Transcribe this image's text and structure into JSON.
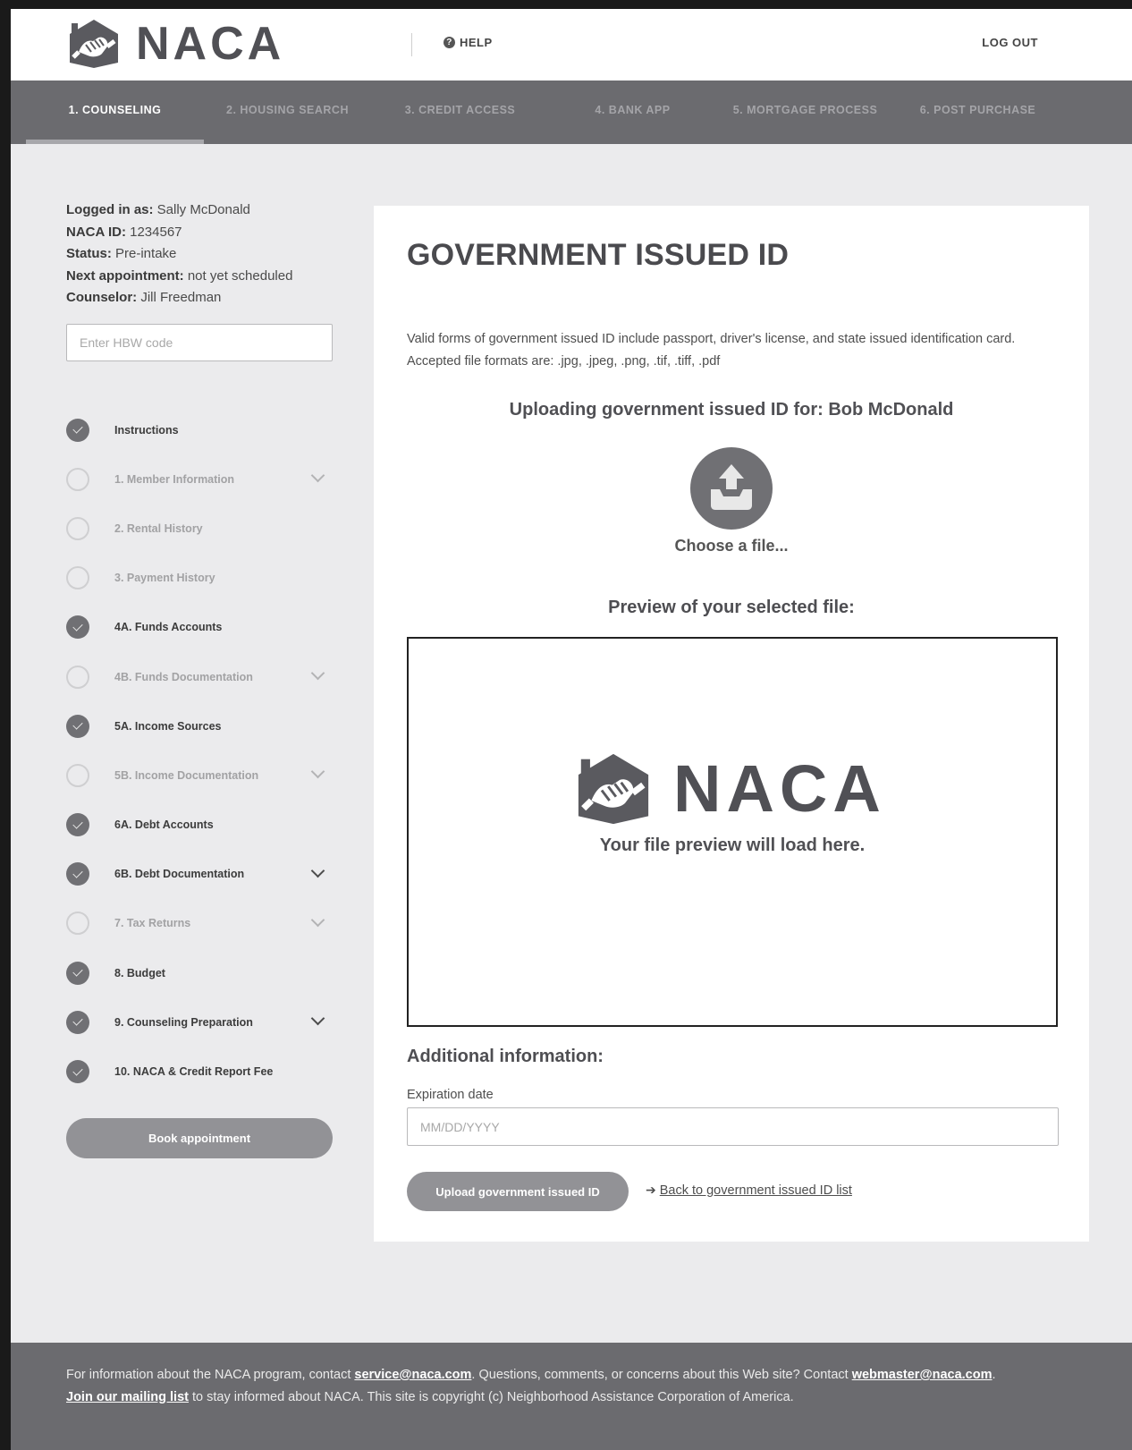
{
  "header": {
    "logo_text": "NACA",
    "help_label": "HELP",
    "logout_label": "LOG OUT"
  },
  "nav": {
    "tabs": [
      {
        "label": "1. COUNSELING",
        "active": true
      },
      {
        "label": "2. HOUSING SEARCH",
        "active": false
      },
      {
        "label": "3. CREDIT ACCESS",
        "active": false
      },
      {
        "label": "4. BANK APP",
        "active": false
      },
      {
        "label": "5. MORTGAGE PROCESS",
        "active": false
      },
      {
        "label": "6. POST PURCHASE",
        "active": false
      }
    ]
  },
  "sidebar": {
    "info": [
      {
        "key": "Logged in as:",
        "value": "Sally McDonald"
      },
      {
        "key": "NACA ID:",
        "value": "1234567"
      },
      {
        "key": "Status:",
        "value": "Pre-intake"
      },
      {
        "key": "Next appointment:",
        "value": "not yet scheduled"
      },
      {
        "key": "Counselor:",
        "value": "Jill Freedman"
      }
    ],
    "hbw_placeholder": "Enter HBW code",
    "steps": [
      {
        "label": "Instructions",
        "done": true,
        "chevron": false
      },
      {
        "label": "1. Member Information",
        "done": false,
        "chevron": true
      },
      {
        "label": "2. Rental History",
        "done": false,
        "chevron": false
      },
      {
        "label": "3. Payment History",
        "done": false,
        "chevron": false
      },
      {
        "label": "4A. Funds Accounts",
        "done": true,
        "chevron": false
      },
      {
        "label": "4B. Funds Documentation",
        "done": false,
        "chevron": true
      },
      {
        "label": "5A. Income Sources",
        "done": true,
        "chevron": false
      },
      {
        "label": "5B. Income Documentation",
        "done": false,
        "chevron": true
      },
      {
        "label": "6A. Debt Accounts",
        "done": true,
        "chevron": false
      },
      {
        "label": "6B. Debt Documentation",
        "done": true,
        "chevron": true
      },
      {
        "label": "7. Tax Returns",
        "done": false,
        "chevron": true
      },
      {
        "label": "8. Budget",
        "done": true,
        "chevron": false
      },
      {
        "label": "9. Counseling Preparation",
        "done": true,
        "chevron": true
      },
      {
        "label": "10. NACA & Credit Report Fee",
        "done": true,
        "chevron": false
      }
    ],
    "book_label": "Book appointment"
  },
  "main": {
    "title": "GOVERNMENT ISSUED ID",
    "description": "Valid forms of government issued ID include passport, driver's license, and state issued identification card. Accepted file formats are: .jpg, .jpeg, .png, .tif, .tiff, .pdf",
    "uploading_for": "Uploading government issued ID for: Bob McDonald",
    "choose_file": "Choose a file...",
    "preview_heading": "Preview of your selected file:",
    "preview_logo_text": "NACA",
    "preview_message": "Your file preview will load here.",
    "additional_heading": "Additional information:",
    "expiration_label": "Expiration date",
    "expiration_placeholder": "MM/DD/YYYY",
    "upload_button": "Upload government issued ID",
    "back_link": " Back to government issued ID list"
  },
  "footer": {
    "t1": "For information about the NACA program, contact ",
    "service_email": "service@naca.com",
    "t2": ". Questions, comments, or concerns about this Web site? Contact ",
    "webmaster_email": "webmaster@naca.com",
    "t3": ". ",
    "mailing_list": "Join our mailing list",
    "t4": " to stay informed about NACA. This site is copyright (c) Neighborhood Assistance Corporation of America."
  }
}
